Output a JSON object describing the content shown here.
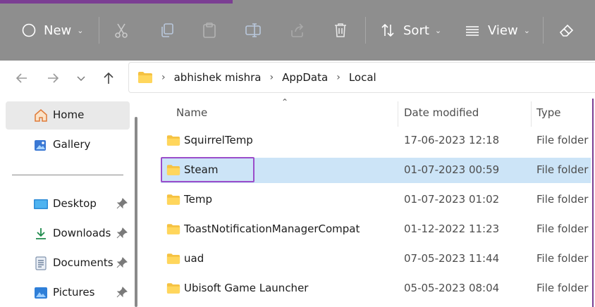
{
  "commandbar": {
    "new_label": "New",
    "sort_label": "Sort",
    "view_label": "View"
  },
  "address": {
    "breadcrumbs": [
      "abhishek mishra",
      "AppData",
      "Local"
    ]
  },
  "sidebar": {
    "items": [
      {
        "label": "Home",
        "icon": "home-icon",
        "selected": true
      },
      {
        "label": "Gallery",
        "icon": "gallery-icon"
      },
      {
        "label": "Desktop",
        "icon": "desktop-icon",
        "pinned": true
      },
      {
        "label": "Downloads",
        "icon": "downloads-icon",
        "pinned": true
      },
      {
        "label": "Documents",
        "icon": "documents-icon",
        "pinned": true
      },
      {
        "label": "Pictures",
        "icon": "pictures-icon",
        "pinned": true
      }
    ]
  },
  "filelist": {
    "columns": {
      "name": "Name",
      "date": "Date modified",
      "type": "Type"
    },
    "rows": [
      {
        "name": "SquirrelTemp",
        "date": "17-06-2023 12:18",
        "type": "File folder"
      },
      {
        "name": "Steam",
        "date": "01-07-2023 00:59",
        "type": "File folder",
        "selected": true
      },
      {
        "name": "Temp",
        "date": "01-07-2023 01:02",
        "type": "File folder"
      },
      {
        "name": "ToastNotificationManagerCompat",
        "date": "01-12-2022 11:23",
        "type": "File folder"
      },
      {
        "name": "uad",
        "date": "07-05-2023 11:44",
        "type": "File folder"
      },
      {
        "name": "Ubisoft Game Launcher",
        "date": "05-05-2023 08:04",
        "type": "File folder"
      }
    ]
  },
  "colors": {
    "accent_purple": "#9b4dca",
    "selection": "#cce4f7",
    "folder_yellow": "#f5c242"
  }
}
